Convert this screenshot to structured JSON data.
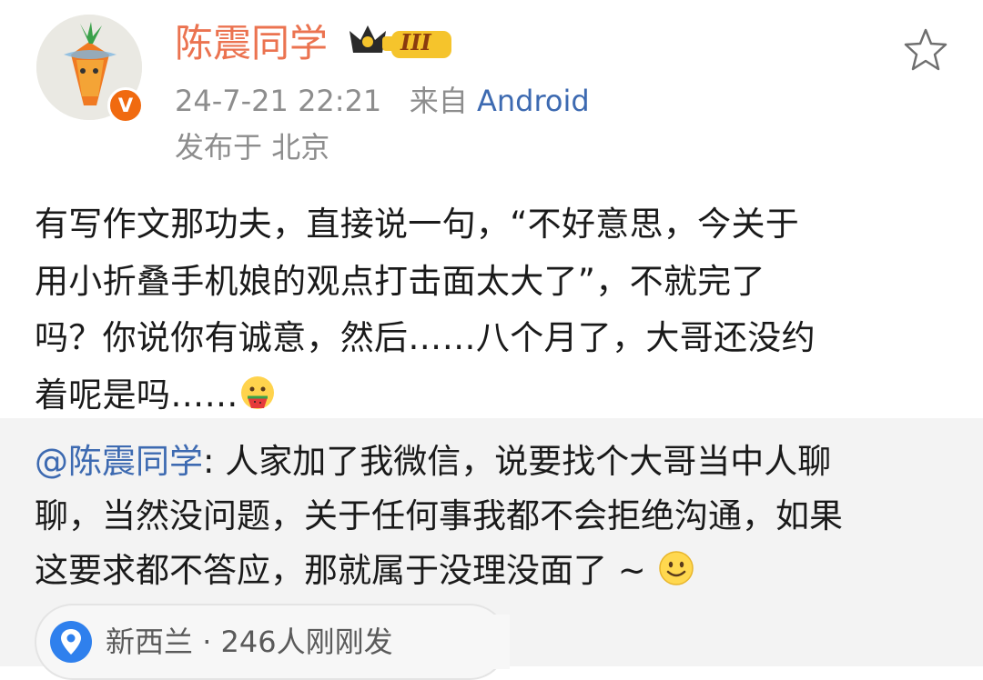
{
  "post": {
    "username": "陈震同学",
    "rank_badge": "III",
    "verified_mark": "V",
    "timestamp": "24-7-21 22:21",
    "from_label": "来自",
    "client": "Android",
    "location_prefix": "发布于",
    "location": "北京",
    "text_lines": [
      "有写作文那功夫，直接说一句，“不好意思，今关于",
      "用小折叠手机娘的观点打击面太大了”，不就完了",
      "吗？你说你有诚意，然后……八个月了，大哥还没约",
      "着呢是吗……"
    ],
    "end_emoji": "watermelon-face-emoji"
  },
  "repost": {
    "mention": "@陈震同学",
    "separator": ":",
    "line1": " 人家加了我微信，说要找个大哥当中人聊",
    "line2": "聊，当然没问题，关于任何事我都不会拒绝沟通，如果",
    "line3": "这要求都不答应，那就属于没理没面了 ~",
    "end_emoji": "smile-emoji"
  },
  "footer": {
    "place": "新西兰",
    "dot": "·",
    "visitors": "246人刚刚发"
  },
  "colors": {
    "username": "#eb7350",
    "link": "#3d6ab1",
    "meta": "#8d8d8d",
    "repost_bg": "#f3f3f3",
    "verified": "#f06a10"
  }
}
